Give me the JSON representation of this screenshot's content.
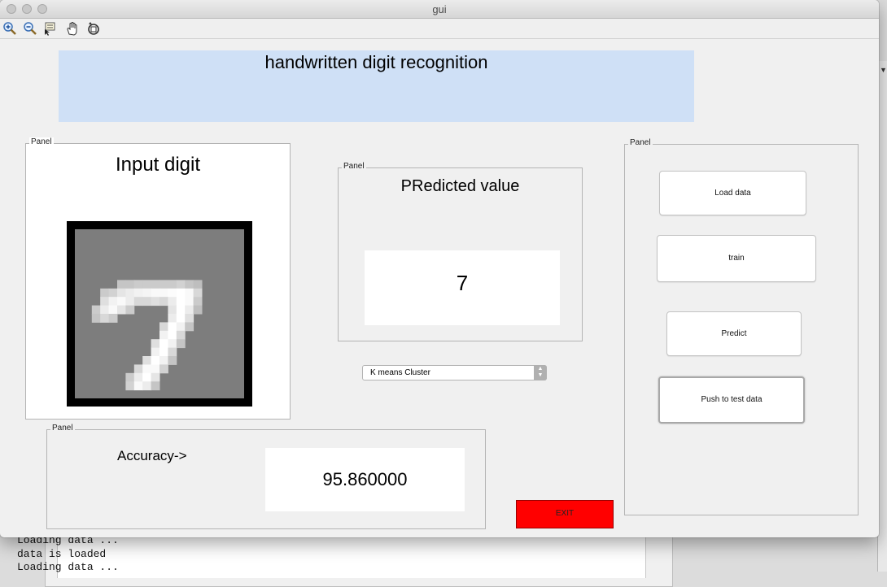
{
  "window": {
    "title": "gui"
  },
  "toolbar": {
    "tools": [
      "zoom-in-icon",
      "zoom-out-icon",
      "data-cursor-icon",
      "pan-hand-icon",
      "rotate-3d-icon"
    ]
  },
  "header": {
    "title": "handwritten digit recognition"
  },
  "input_panel": {
    "panel_label": "Panel",
    "title": "Input digit"
  },
  "predicted_panel": {
    "panel_label": "Panel",
    "title": "PRedicted value",
    "value": "7"
  },
  "method_select": {
    "selected": "K means Cluster"
  },
  "accuracy_panel": {
    "panel_label": "Panel",
    "label": "Accuracy->",
    "value": "95.860000"
  },
  "controls_panel": {
    "panel_label": "Panel",
    "load_label": "Load data",
    "train_label": "train",
    "predict_label": "Predict",
    "push_label": "Push to test data"
  },
  "exit_button": {
    "label": "EXIT",
    "color": "#ff0000"
  },
  "console": {
    "lines": [
      "Loading data ...",
      "data is loaded",
      "Loading data ..."
    ]
  },
  "colors": {
    "header_bg": "#cfe0f6",
    "window_bg": "#f0f0f0"
  }
}
